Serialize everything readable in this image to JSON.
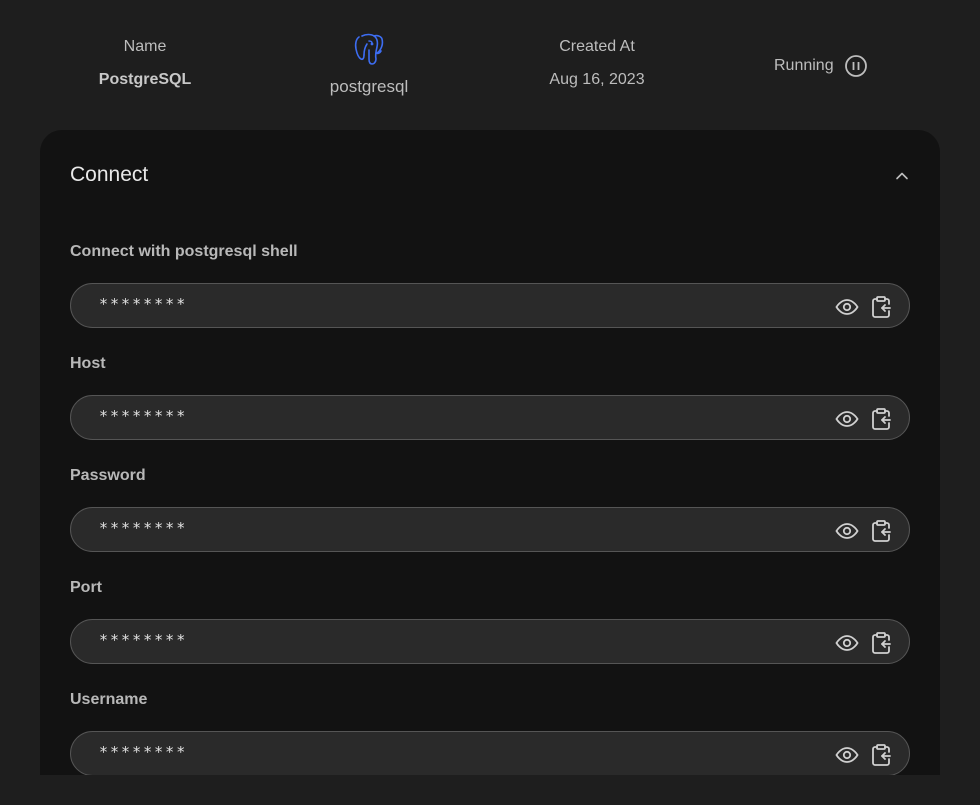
{
  "summary": {
    "name_label": "Name",
    "name_value": "PostgreSQL",
    "engine_icon": "postgresql-elephant-icon",
    "engine_value": "postgresql",
    "created_label": "Created At",
    "created_value": "Aug 16, 2023",
    "status_value": "Running",
    "status_icon": "pause-circle-icon"
  },
  "panel": {
    "title": "Connect",
    "collapse_icon": "chevron-up-icon",
    "fields": [
      {
        "label": "Connect with postgresql shell",
        "value": "********"
      },
      {
        "label": "Host",
        "value": "********"
      },
      {
        "label": "Password",
        "value": "********"
      },
      {
        "label": "Port",
        "value": "********"
      },
      {
        "label": "Username",
        "value": "********"
      }
    ]
  },
  "colors": {
    "background": "#1e1e1e",
    "panel": "#121212",
    "field_background": "#2a2a2a",
    "field_border": "#555555",
    "engine_icon": "#3d6df2"
  }
}
